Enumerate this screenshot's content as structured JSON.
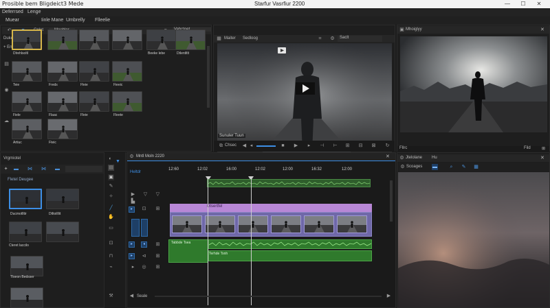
{
  "titlebar": {
    "app_name": "Prosible bem Bligdeict3 Mede",
    "window_title": "Starfur Vasrfiur 2200",
    "minimize": "—",
    "maximize": "☐",
    "close": "✕"
  },
  "menu": {
    "items": [
      "Deferrsed",
      "Lenge"
    ]
  },
  "toolbar": {
    "tabs": [
      "Muear",
      "Iinle Mane",
      "Umbrelly",
      "Flleelie"
    ]
  },
  "project_panel": {
    "header_left": "Cnlet",
    "header_right": "Moobler",
    "subheader": "Dukes  Uasie Ib",
    "search_label": "Vahctoet",
    "add_label": "+ Enib",
    "thumbs": [
      {
        "caption": "Dlrehlsoltl",
        "selected": true
      },
      {
        "caption": "",
        "selected": false
      },
      {
        "caption": "",
        "selected": false
      },
      {
        "caption": "",
        "selected": false
      },
      {
        "caption": "Beeke lebe",
        "selected": false
      },
      {
        "caption": "Dtlentltlt",
        "selected": false
      },
      {
        "caption": "Teie",
        "selected": false
      },
      {
        "caption": "Freds",
        "selected": false
      },
      {
        "caption": "Fleie",
        "selected": false
      },
      {
        "caption": "Fieeic",
        "selected": false
      },
      {
        "caption": "Fiele",
        "selected": false
      },
      {
        "caption": "Flaac",
        "selected": false
      },
      {
        "caption": "Fleie",
        "selected": false
      },
      {
        "caption": "Fleete",
        "selected": false
      },
      {
        "caption": "Artiuc",
        "selected": false
      },
      {
        "caption": "Fteic",
        "selected": false
      }
    ]
  },
  "source_monitor": {
    "tab1": "Maiter",
    "tab2": "Sedloog",
    "search_placeholder": "Saclt",
    "timecode": "Sunuler Tuun",
    "label": "Chsec"
  },
  "program_monitor": {
    "title": "Mhoiglyy",
    "bottom_label": "Fllrc",
    "bottom_right": "Fild"
  },
  "effects_panel": {
    "title": "Vrgmiotel",
    "section": "Fletel Deugee",
    "items": [
      {
        "caption": "Ducmotlltir"
      },
      {
        "caption": "Dtltoilllit"
      },
      {
        "caption": "Cteret laccilo"
      },
      {
        "caption": "Tlseon Bedsser"
      }
    ]
  },
  "timeline": {
    "tab": "Mntl Moln 2220",
    "track_label": "Heltdr",
    "ruler": [
      "12:60",
      "12:02",
      "16:00",
      "12:02",
      "12:00",
      "16:32",
      "12:00"
    ],
    "video_clip_label": "Dtsertfel",
    "audio_label1": "Tabbde  Tsea",
    "audio_label2": "Terhde  Tsnh",
    "bottom": "Seale"
  },
  "scopes_panel": {
    "tab1": "Jtelolane",
    "tab2": "Hu",
    "section": "Scoages"
  },
  "colors": {
    "accent_blue": "#3d8fe6",
    "clip_purple": "#c08be0",
    "audio_green": "#3d8a3c",
    "selection_yellow": "#d6b64a"
  }
}
